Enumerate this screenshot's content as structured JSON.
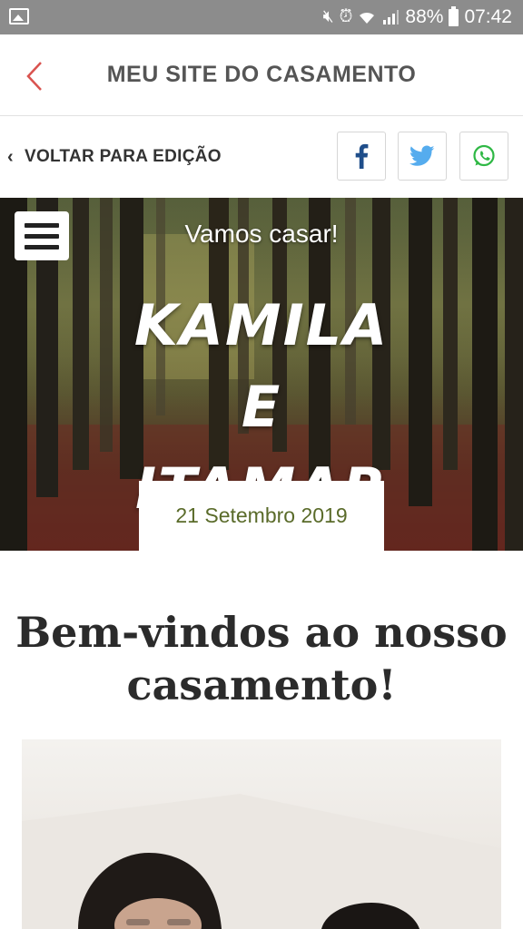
{
  "status_bar": {
    "battery": "88%",
    "time": "07:42",
    "icons": [
      "gallery-icon",
      "mute-icon",
      "alarm-icon",
      "wifi-icon",
      "signal-icon",
      "battery-icon"
    ]
  },
  "app_bar": {
    "title": "MEU SITE DO CASAMENTO",
    "back_icon": "chevron-left-icon",
    "accent": "#d9534f"
  },
  "toolbar": {
    "return_label": "VOLTAR PARA EDIÇÃO",
    "share": [
      {
        "name": "facebook",
        "icon": "facebook-icon",
        "color": "#1f4e8a"
      },
      {
        "name": "twitter",
        "icon": "twitter-icon",
        "color": "#55acee"
      },
      {
        "name": "whatsapp",
        "icon": "whatsapp-icon",
        "color": "#2fb845"
      }
    ]
  },
  "hero": {
    "tagline": "Vamos casar!",
    "names_line1": "KAMILA E",
    "names_line2": "ITAMAR",
    "date": "21 Setembro 2019",
    "date_color": "#5a6b2a"
  },
  "welcome": {
    "line1": "Bem-vindos ao nosso",
    "line2": "casamento!"
  }
}
